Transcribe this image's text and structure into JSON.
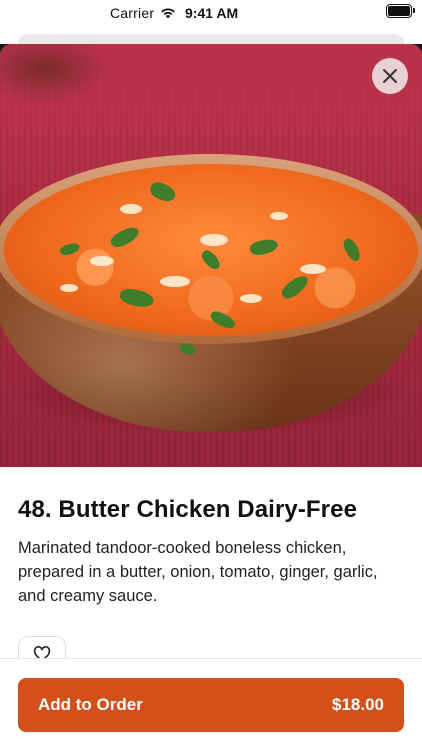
{
  "status_bar": {
    "carrier": "Carrier",
    "time": "9:41 AM",
    "wifi_icon": "wifi-icon",
    "battery_icon": "battery-icon"
  },
  "item": {
    "title": "48. Butter Chicken Dairy-Free",
    "description": "Marinated tandoor-cooked boneless chicken, prepared in a butter, onion, tomato, ginger, garlic, and creamy sauce.",
    "image_icon": "butter-chicken-photo"
  },
  "actions": {
    "close_icon": "close-icon",
    "favorite_icon": "heart-icon",
    "add_label": "Add to Order",
    "price": "$18.00"
  },
  "colors": {
    "accent": "#d4501a",
    "surface": "#ffffff"
  }
}
